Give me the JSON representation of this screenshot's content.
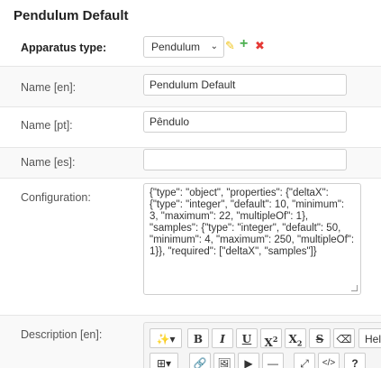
{
  "page_title": "Pendulum Default",
  "apparatus": {
    "label": "Apparatus type:",
    "selected": "Pendulum",
    "chevron": "⌄",
    "edit_icon": "✎",
    "add_icon": "+",
    "delete_icon": "✖"
  },
  "fields": {
    "name_en": {
      "label": "Name [en]:",
      "value": "Pendulum Default"
    },
    "name_pt": {
      "label": "Name [pt]:",
      "value": "Pêndulo"
    },
    "name_es": {
      "label": "Name [es]:",
      "value": ""
    },
    "configuration": {
      "label": "Configuration:",
      "value": "{\"type\": \"object\", \"properties\": {\"deltaX\": {\"type\": \"integer\", \"default\": 10, \"minimum\": 3, \"maximum\": 22, \"multipleOf\": 1}, \"samples\": {\"type\": \"integer\", \"default\": 50, \"minimum\": 4, \"maximum\": 250, \"multipleOf\": 1}}, \"required\": [\"deltaX\", \"samples\"]}"
    },
    "description_en": {
      "label": "Description [en]:"
    }
  },
  "toolbar": {
    "style": "✨▾",
    "bold": "B",
    "italic": "I",
    "underline": "U",
    "superscript": "X",
    "superscript_mark": "2",
    "subscript": "X",
    "subscript_mark": "2",
    "strikethrough": "S",
    "eraser": "⌫",
    "font": "Helv",
    "table": "⊞▾",
    "link": "🔗",
    "picture": "🖼",
    "video": "▶",
    "hr": "—",
    "fullscreen": "⤢",
    "code": "</>",
    "help": "?"
  },
  "colors": {
    "edit": "#f0c419",
    "add": "#4caf50",
    "delete": "#e53935"
  }
}
